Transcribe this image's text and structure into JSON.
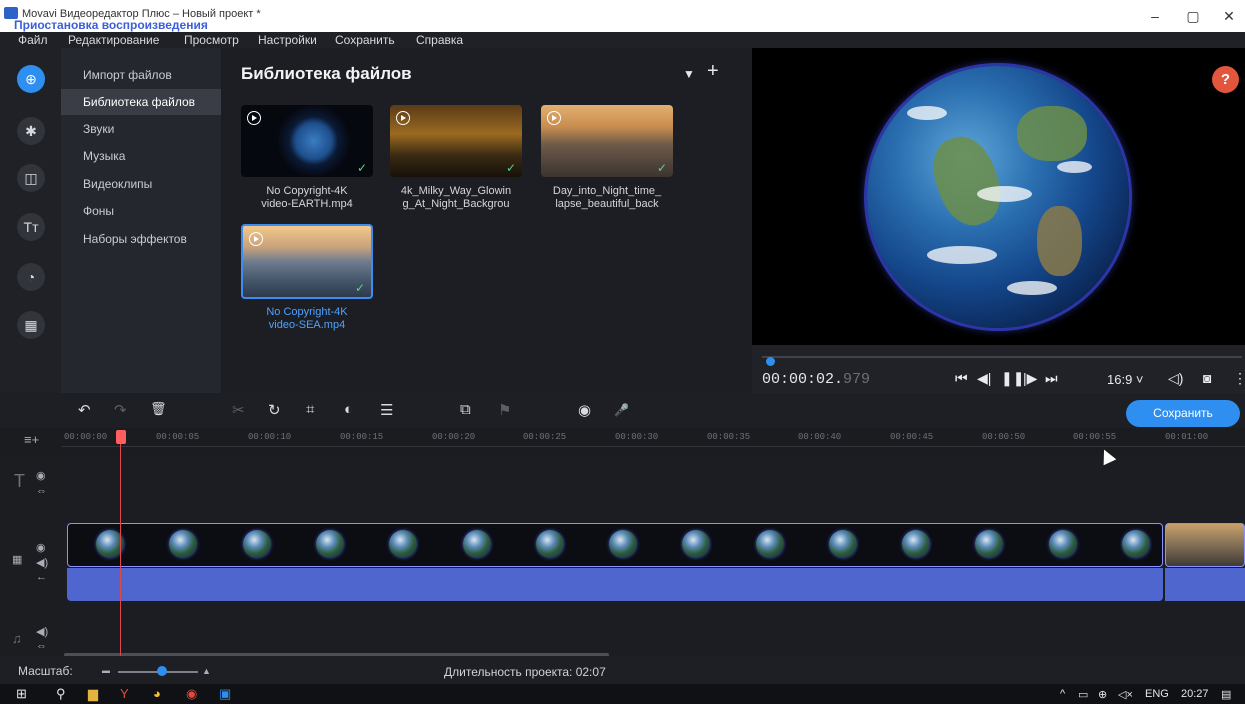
{
  "window": {
    "title": "Movavi Видеоредактор Плюс – Новый проект *",
    "overlay": "Приостановка воспроизведения",
    "minimize": "–",
    "maximize": "▢",
    "close": "✕"
  },
  "menu": [
    "Файл",
    "Редактирование",
    "Просмотр",
    "Настройки",
    "Сохранить",
    "Справка"
  ],
  "leftbar": [
    {
      "icon": "import-icon",
      "glyph": "⊕",
      "active": true
    },
    {
      "icon": "effects-wand-icon",
      "glyph": "✱",
      "active": false
    },
    {
      "icon": "transitions-icon",
      "glyph": "◫",
      "active": false
    },
    {
      "icon": "titles-icon",
      "glyph": "Tт",
      "active": false
    },
    {
      "icon": "stickers-icon",
      "glyph": "◔",
      "active": false
    },
    {
      "icon": "more-tools-icon",
      "glyph": "▦",
      "active": false
    }
  ],
  "categories": [
    "Импорт файлов",
    "Библиотека файлов",
    "Звуки",
    "Музыка",
    "Видеоклипы",
    "Фоны",
    "Наборы эффектов"
  ],
  "library": {
    "title": "Библиотека файлов",
    "filter_glyph": "▼",
    "add_glyph": "+",
    "files": [
      {
        "line1": "No Copyright-4K",
        "line2": "video-EARTH.mp4"
      },
      {
        "line1": "4k_Milky_Way_Glowin",
        "line2": "g_At_Night_Backgrou"
      },
      {
        "line1": "Day_into_Night_time_",
        "line2": "lapse_beautiful_back"
      },
      {
        "line1": "No Copyright-4K",
        "line2": "video-SEA.mp4"
      }
    ]
  },
  "player": {
    "help": "?",
    "time_main": "00:00:02.",
    "time_ms": "979",
    "aspect": "16:9 ˅",
    "controls": [
      "⏮",
      "◀|",
      "❚❚",
      "|▶",
      "⏭"
    ],
    "volume_glyph": "◁)",
    "snapshot_glyph": "◙",
    "more_glyph": "⋮"
  },
  "toolbar": {
    "undo": "↶",
    "redo": "↷",
    "delete": "🗑",
    "cut": "✂",
    "rotate": "↻",
    "crop": "⌗",
    "color": "◐",
    "adjust": "☰",
    "overlay": "⧉",
    "marker": "⚑",
    "record_cam": "◉",
    "record_mic": "🎤",
    "save_label": "Сохранить"
  },
  "ruler": [
    "00:00:00",
    "00:00:05",
    "00:00:10",
    "00:00:15",
    "00:00:20",
    "00:00:25",
    "00:00:30",
    "00:00:35",
    "00:00:40",
    "00:00:45",
    "00:00:50",
    "00:00:55",
    "00:01:00"
  ],
  "status": {
    "scale_label": "Масштаб:",
    "zoom_minus": "▬",
    "zoom_plus": "▲",
    "duration_label": "Длительность проекта: 02:07"
  },
  "taskbar": {
    "start": "⊞",
    "search": "⚲",
    "explorer": "▆",
    "yandex": "Y",
    "chrome": "◕",
    "record": "◉",
    "movavi": "▣",
    "tray_arrow": "^",
    "lang": "ENG",
    "clock": "20:27",
    "notif": "▤"
  }
}
